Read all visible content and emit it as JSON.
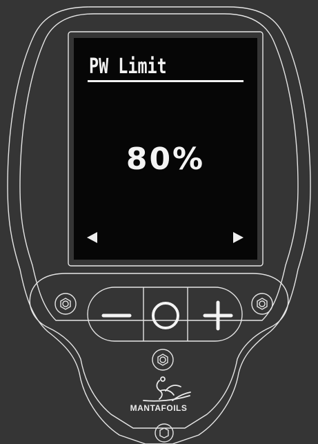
{
  "screen": {
    "title": "PW Limit",
    "value": "80%"
  },
  "controls": {
    "minus_icon": "minus-icon",
    "center_icon": "circle-icon",
    "plus_icon": "plus-icon",
    "nav_left_icon": "triangle-left-icon",
    "nav_right_icon": "triangle-right-icon"
  },
  "brand": {
    "name": "MANTAFOILS"
  },
  "colors": {
    "background": "#353535",
    "screen": "#060606",
    "outline": "#e8e8e8",
    "text": "#f2f2f2"
  }
}
